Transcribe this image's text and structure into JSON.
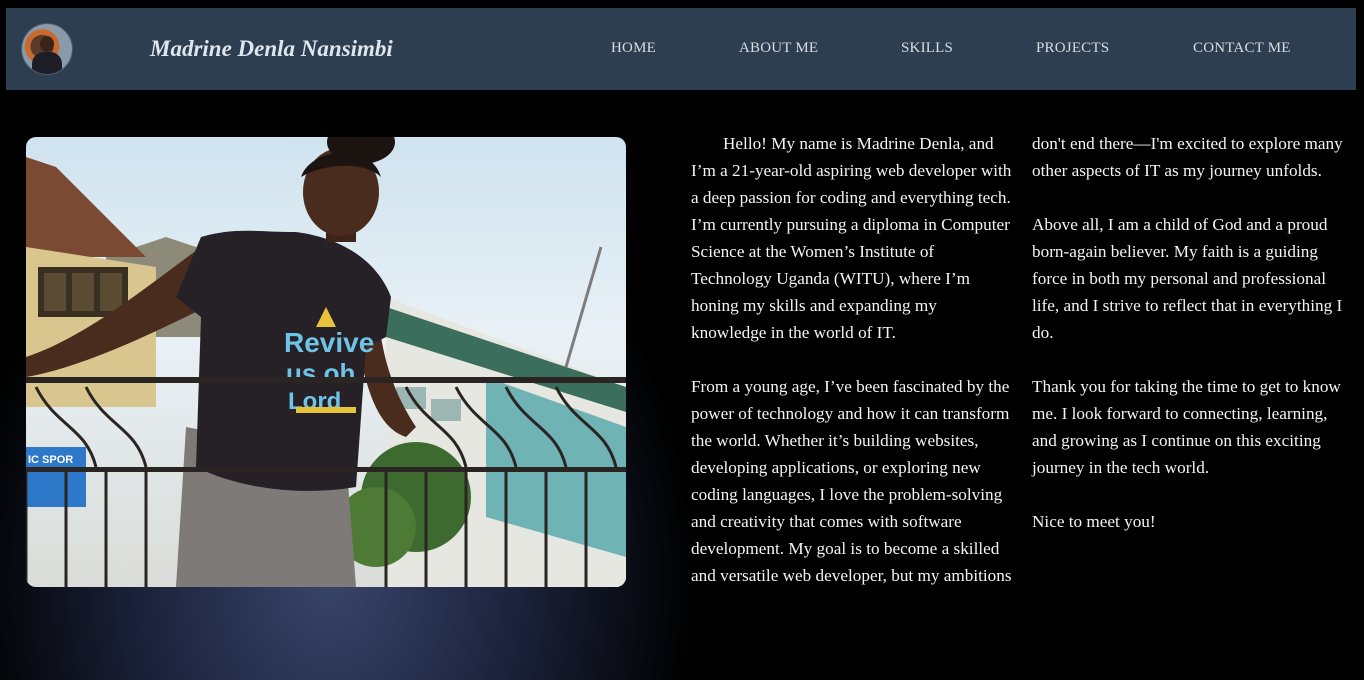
{
  "header": {
    "brand": "Madrine Denla Nansimbi",
    "nav": [
      "HOME",
      "ABOUT ME",
      "SKILLS",
      "PROJECTS",
      "CONTACT ME"
    ]
  },
  "photo": {
    "shirt_text": [
      "Revive",
      "us oh",
      "Lord"
    ],
    "sign_text": "IC SPOR"
  },
  "about": {
    "paragraphs": [
      "Hello! My name is Madrine Denla, and I’m a 21-year-old aspiring web developer with a deep passion for coding and everything tech. I’m currently pursuing a diploma in Computer Science at the Women’s Institute of Technology Uganda (WITU), where I’m honing my skills and expanding my knowledge in the world of IT.",
      "From a young age, I’ve been fascinated by the power of technology and how it can transform the world. Whether it’s building websites, developing applications, or exploring new coding languages, I love the problem-solving and creativity that comes with software development. My goal is to become a skilled and versatile web developer, but my ambitions don't end there—I'm excited to explore many other aspects of IT as my journey unfolds.",
      "Above all, I am a child of God and a proud born-again believer. My faith is a guiding force in both my personal and professional life, and I strive to reflect that in everything I do.",
      "Thank you for taking the time to get to know me. I look forward to connecting, learning, and growing as I continue on this exciting journey in the tech world.",
      "Nice to meet you!"
    ]
  },
  "colors": {
    "navbar": "#2c3e50",
    "background": "#000000",
    "text": "#f4f4f4"
  }
}
